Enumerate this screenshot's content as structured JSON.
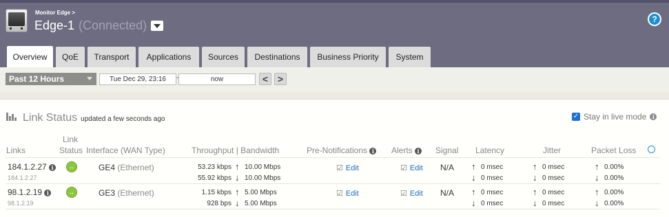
{
  "header": {
    "breadcrumb": "Monitor Edge >",
    "edge_name": "Edge-1",
    "edge_status": "(Connected)",
    "help_symbol": "?"
  },
  "tabs": [
    {
      "label": "Overview",
      "active": true
    },
    {
      "label": "QoE",
      "active": false
    },
    {
      "label": "Transport",
      "active": false
    },
    {
      "label": "Applications",
      "active": false
    },
    {
      "label": "Sources",
      "active": false
    },
    {
      "label": "Destinations",
      "active": false
    },
    {
      "label": "Business Priority",
      "active": false
    },
    {
      "label": "System",
      "active": false
    }
  ],
  "toolbar": {
    "range": "Past 12 Hours",
    "start": "Tue Dec 29, 23:16",
    "separator": "-",
    "end": "now",
    "prev_symbol": "<",
    "next_symbol": ">"
  },
  "panel": {
    "title": "Link Status",
    "updated": "updated a few seconds ago",
    "live_mode_label": "Stay in live mode",
    "live_mode_checked": true
  },
  "columns": {
    "links": "Links",
    "link_status_1": "Link",
    "link_status_2": "Status",
    "interface": "Interface (WAN Type)",
    "throughput": "Throughput | Bandwidth",
    "pre_notifications": "Pre-Notifications",
    "alerts": "Alerts",
    "signal": "Signal",
    "latency": "Latency",
    "jitter": "Jitter",
    "packet_loss": "Packet Loss"
  },
  "rows": [
    {
      "link": "184.1.2.27",
      "link_sub": "184.1.2.27",
      "status_symbol": "↔",
      "interface": "GE4",
      "wan_type": "(Ethernet)",
      "throughput_up": "53.23 kbps",
      "throughput_down": "55.92 kbps",
      "bandwidth_up": "10.00 Mbps",
      "bandwidth_down": "10.00 Mbps",
      "pre_notifications": "Edit",
      "alerts": "Edit",
      "signal": "N/A",
      "latency_up": "0 msec",
      "latency_down": "0 msec",
      "jitter_up": "0 msec",
      "jitter_down": "0 msec",
      "loss_up": "0.00%",
      "loss_down": "0.00%"
    },
    {
      "link": "98.1.2.19",
      "link_sub": "98.1.2.19",
      "status_symbol": "↔",
      "interface": "GE3",
      "wan_type": "(Ethernet)",
      "throughput_up": "1.15 kbps",
      "throughput_down": "928 bps",
      "bandwidth_up": "5.00 Mbps",
      "bandwidth_down": "5.00 Mbps",
      "pre_notifications": "Edit",
      "alerts": "Edit",
      "signal": "N/A",
      "latency_up": "0 msec",
      "latency_down": "0 msec",
      "jitter_up": "0 msec",
      "jitter_down": "0 msec",
      "loss_up": "0.00%",
      "loss_down": "0.00%"
    }
  ],
  "icons": {
    "up_arrow": "↑",
    "down_arrow": "↓",
    "info": "i",
    "check": "✓",
    "edit": "☑",
    "expand": "⊙"
  },
  "colors": {
    "header_bg": "#6e6c80",
    "accent": "#1b6fc2",
    "status_ok": "#8cc63f"
  }
}
